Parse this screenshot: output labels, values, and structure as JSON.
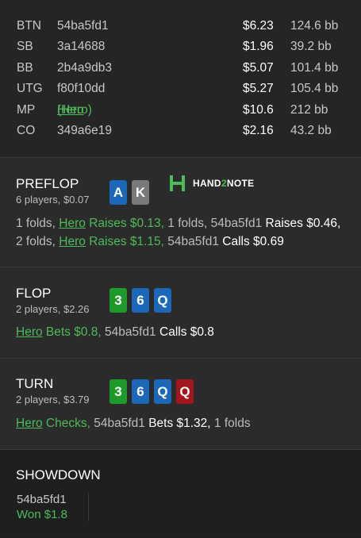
{
  "players": [
    {
      "position": "BTN",
      "id": "54ba5fd1",
      "amount": "$6.23",
      "bb": "124.6 bb"
    },
    {
      "position": "SB",
      "id": "3a14688",
      "amount": "$1.96",
      "bb": "39.2 bb"
    },
    {
      "position": "BB",
      "id": "2b4a9db3",
      "amount": "$5.07",
      "bb": "101.4 bb"
    },
    {
      "position": "UTG",
      "id": "f80f10dd",
      "amount": "$5.27",
      "bb": "105.4 bb"
    },
    {
      "position": "MP",
      "id_name": "Hero",
      "id_suffix": " (Hero)",
      "amount": "$10.6",
      "bb": "212 bb"
    },
    {
      "position": "CO",
      "id": "349a6e19",
      "amount": "$2.16",
      "bb": "43.2 bb"
    }
  ],
  "logo": {
    "text_a": "HAND",
    "text_b": "2",
    "text_c": "NOTE"
  },
  "preflop": {
    "title": "PREFLOP",
    "subtitle": "6 players, $0.07",
    "cards": [
      {
        "rank": "A",
        "color": "#1b67b8"
      },
      {
        "rank": "K",
        "color": "#7a7a7a"
      }
    ],
    "actions": {
      "a1": "1 folds, ",
      "a2_name": "Hero",
      "a2_text": " Raises $0.13, ",
      "a3": "1 folds, 54ba5fd1 ",
      "a4": "Raises $0.46, ",
      "a5": "2 folds, ",
      "a6_name": "Hero",
      "a6_text": " Raises $1.15, ",
      "a7": "54ba5fd1 ",
      "a8": "Calls $0.69"
    }
  },
  "flop": {
    "title": "FLOP",
    "subtitle": "2 players, $2.26",
    "cards": [
      {
        "rank": "3",
        "color": "#1e9a2a"
      },
      {
        "rank": "6",
        "color": "#1b67b8"
      },
      {
        "rank": "Q",
        "color": "#1b67b8"
      }
    ],
    "actions": {
      "a1_name": "Hero",
      "a1_text": " Bets $0.8, ",
      "a2": "54ba5fd1 ",
      "a3": "Calls $0.8"
    }
  },
  "turn": {
    "title": "TURN",
    "subtitle": "2 players, $3.79",
    "cards": [
      {
        "rank": "3",
        "color": "#1e9a2a"
      },
      {
        "rank": "6",
        "color": "#1b67b8"
      },
      {
        "rank": "Q",
        "color": "#1b67b8"
      },
      {
        "rank": "Q",
        "color": "#a3161d"
      }
    ],
    "actions": {
      "a1_name": "Hero",
      "a1_text": " Checks, ",
      "a2": "54ba5fd1 ",
      "a3": "Bets $1.32, ",
      "a4": "1 folds"
    }
  },
  "showdown": {
    "title": "SHOWDOWN",
    "player": "54ba5fd1",
    "result": "Won $1.8"
  },
  "colors": {
    "accent_green": "#4cbb5a",
    "card_blue": "#1b67b8",
    "card_red": "#a3161d",
    "card_green": "#1e9a2a",
    "card_grey": "#7a7a7a"
  }
}
